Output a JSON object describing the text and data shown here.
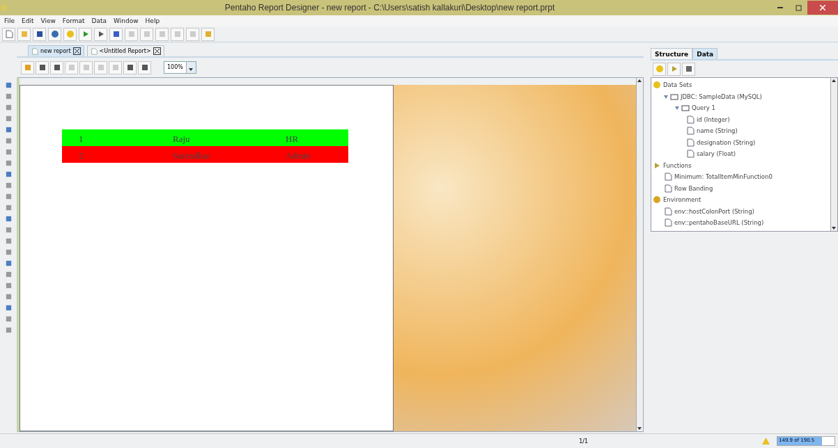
{
  "window": {
    "title": "Pentaho Report Designer - new report - C:\\Users\\satish kallakuri\\Desktop\\new report.prpt"
  },
  "menu": [
    "File",
    "Edit",
    "View",
    "Format",
    "Data",
    "Window",
    "Help"
  ],
  "doc_tabs": [
    {
      "label": "new report",
      "selected": true
    },
    {
      "label": "<Untitled Report>",
      "selected": false
    }
  ],
  "zoom": {
    "value": "100%"
  },
  "report_rows": [
    {
      "cells": [
        "1",
        "Raju",
        "HR"
      ],
      "color": "#00ff00"
    },
    {
      "cells": [
        "2",
        "Surendhar",
        "Admin"
      ],
      "color": "#ff0000"
    }
  ],
  "side_tabs": [
    {
      "label": "Structure",
      "selected": false
    },
    {
      "label": "Data",
      "selected": true
    }
  ],
  "tree": [
    {
      "label": "Data Sets",
      "children": [
        {
          "label": "JDBC: SampleData (MySQL)",
          "expanded": true,
          "children": [
            {
              "label": "Query 1",
              "expanded": true,
              "children": [
                {
                  "label": "id (Integer)"
                },
                {
                  "label": "name (String)"
                },
                {
                  "label": "designation (String)"
                },
                {
                  "label": "salary (Float)"
                }
              ]
            }
          ]
        }
      ]
    },
    {
      "label": "Functions",
      "children": [
        {
          "label": "Minimum: TotalItemMinFunction0"
        },
        {
          "label": "Row Banding"
        }
      ]
    },
    {
      "label": "Environment",
      "children": [
        {
          "label": "env::hostColonPort (String)"
        },
        {
          "label": "env::pentahoBaseURL (String)"
        }
      ]
    }
  ],
  "status_bar": {
    "page": "1/1",
    "memory": {
      "text": "149.9 of 190.5",
      "level": 0.78
    }
  }
}
